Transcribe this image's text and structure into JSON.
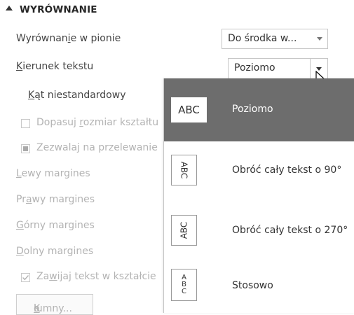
{
  "section": {
    "title": "WYRÓWNANIE",
    "icon": "collapse-triangle-icon"
  },
  "rows": {
    "vertical_align": {
      "label_pre": "Wyrównan",
      "label_u": "i",
      "label_post": "e w pionie",
      "value": "Do środka w..."
    },
    "text_direction": {
      "label_pre": "",
      "label_u": "K",
      "label_post": "ierunek tekstu",
      "value": "Poziomo"
    },
    "custom_angle": {
      "label_pre": "",
      "label_u": "K",
      "label_post": "ąt niestandardowy"
    },
    "autofit": {
      "label_pre": "Dopasuj ",
      "label_u": "r",
      "label_post": "ozmiar kształtu"
    },
    "allow_overflow": {
      "label": "Zezwalaj na przelewanie"
    },
    "left_margin": {
      "label_pre": "",
      "label_u": "L",
      "label_post": "ewy margines"
    },
    "right_margin": {
      "label_pre": "Pr",
      "label_u": "a",
      "label_post": "wy margines"
    },
    "top_margin": {
      "label_pre": "",
      "label_u": "G",
      "label_post": "órny margines"
    },
    "bottom_margin": {
      "label_pre": "",
      "label_u": "D",
      "label_post": "olny margines"
    },
    "wrap_text": {
      "label_pre": "Za",
      "label_u": "w",
      "label_post": "ijaj tekst w kształcie"
    },
    "columns_button": {
      "label_pre": "K",
      "label_u": "o",
      "label_post": "lumny..."
    }
  },
  "dropdown": {
    "options": [
      {
        "label": "Poziomo",
        "icon_text": "ABC",
        "icon": "horizontal-text-icon",
        "selected": true
      },
      {
        "label": "Obróć cały tekst o 90°",
        "icon_text": "ABC",
        "icon": "rotate-90-text-icon",
        "selected": false
      },
      {
        "label": "Obróć cały tekst o 270°",
        "icon_text": "ABC",
        "icon": "rotate-270-text-icon",
        "selected": false
      },
      {
        "label": "Stosowo",
        "icon_text": "ABC",
        "icon": "stacked-text-icon",
        "selected": false
      }
    ]
  },
  "colors": {
    "selected_bg": "#6d6d6d",
    "disabled_text": "#b3b3b3",
    "text": "#444444"
  }
}
